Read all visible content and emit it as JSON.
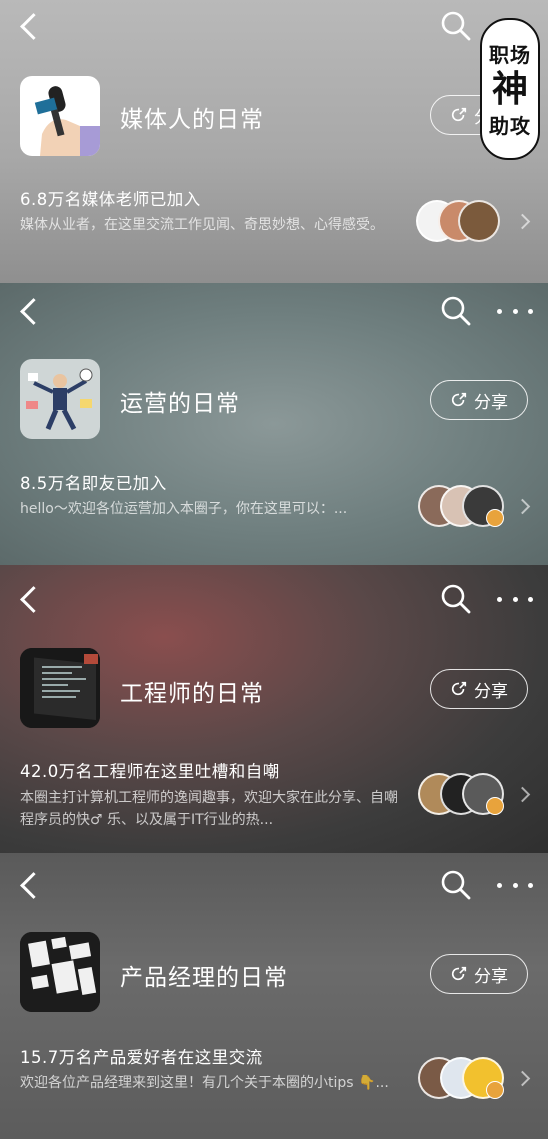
{
  "watermark": {
    "top": "职场",
    "middle": "神",
    "bottom": "助攻"
  },
  "share_label": "分享",
  "panels": [
    {
      "title": "媒体人的日常",
      "stat": "6.8万名媒体老师已加入",
      "desc": "媒体从业者，在这里交流工作见闻、奇思妙想、心得感受。"
    },
    {
      "title": "运营的日常",
      "stat": "8.5万名即友已加入",
      "desc": "hello～欢迎各位运营加入本圈子，你在这里可以：..."
    },
    {
      "title": "工程师的日常",
      "stat": "42.0万名工程师在这里吐槽和自嘲",
      "desc": "本圈主打计算机工程师的逸闻趣事，欢迎大家在此分享、自嘲程序员的快♂ 乐、以及属于IT行业的热..."
    },
    {
      "title": "产品经理的日常",
      "stat": "15.7万名产品爱好者在这里交流",
      "desc": "欢迎各位产品经理来到这里！有几个关于本圈的小tips 👇..."
    }
  ]
}
